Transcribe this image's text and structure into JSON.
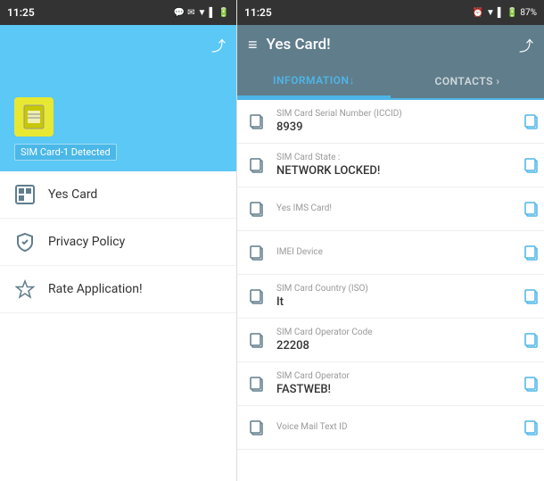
{
  "left_panel": {
    "status_bar": {
      "time": "11:25",
      "icons": [
        "msg",
        "wifi",
        "signal",
        "battery"
      ]
    },
    "top_bar": {
      "share_icon": "⬆"
    },
    "sim_area": {
      "sim_label": "SIM Card-1 Detected"
    },
    "nav_items": [
      {
        "id": "yes-card",
        "label": "Yes Card",
        "icon": "▦"
      },
      {
        "id": "privacy-policy",
        "label": "Privacy Policy",
        "icon": "🛡"
      },
      {
        "id": "rate-application",
        "label": "Rate Application!",
        "icon": "★"
      }
    ]
  },
  "right_panel": {
    "status_bar": {
      "time": "11:25",
      "battery": "87%"
    },
    "header": {
      "title": "Yes Card!",
      "hamburger": "≡",
      "share": "⬆"
    },
    "tabs": [
      {
        "id": "information",
        "label": "INFORMATION",
        "active": true,
        "suffix": "↓"
      },
      {
        "id": "contacts",
        "label": "CONTACTS",
        "active": false,
        "suffix": "›"
      }
    ],
    "info_items": [
      {
        "label": "SIM Card Serial Number (ICCID)",
        "value": "8939"
      },
      {
        "label": "SIM Card State",
        "value": "NETWORK LOCKED!"
      },
      {
        "label": "Yes IMS Card!",
        "value": ""
      },
      {
        "label": "IMEI Device",
        "value": ""
      },
      {
        "label": "SIM Card Country (ISO)",
        "value": "It"
      },
      {
        "label": "SIM Card Operator Code",
        "value": "22208"
      },
      {
        "label": "SIM Card Operator",
        "value": "FASTWEB!"
      },
      {
        "label": "Voice Mail Text ID",
        "value": ""
      }
    ]
  }
}
